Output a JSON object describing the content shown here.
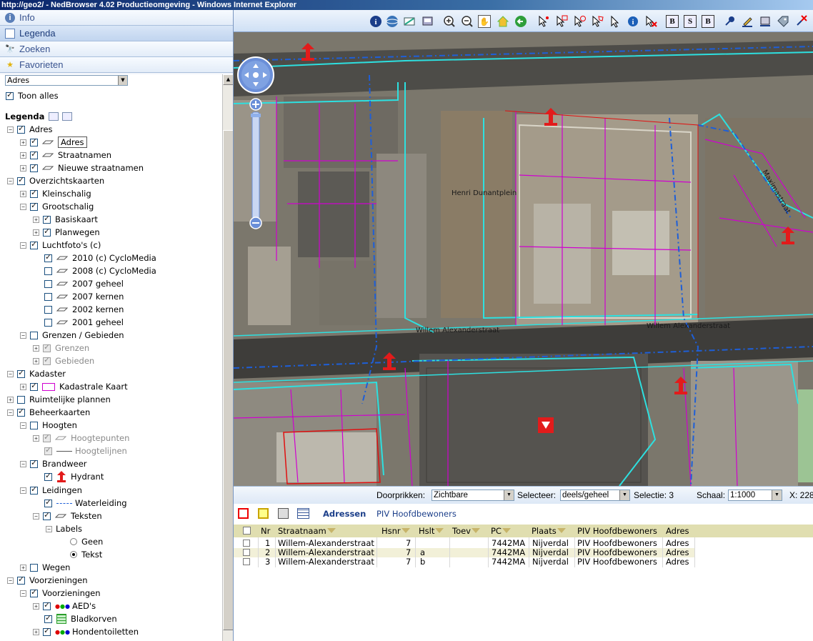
{
  "window": {
    "title": "http://geo2/ - NedBrowser 4.02 Productieomgeving - Windows Internet Explorer"
  },
  "nav": {
    "info": "Info",
    "legenda": "Legenda",
    "zoeken": "Zoeken",
    "favorieten": "Favorieten"
  },
  "layer_select": {
    "value": "Adres"
  },
  "toon_alles": "Toon alles",
  "legend_title": "Legenda",
  "tree": {
    "adres": "Adres",
    "adres_sub": "Adres",
    "straatnamen": "Straatnamen",
    "nieuwe_straatnamen": "Nieuwe straatnamen",
    "overzichtskaarten": "Overzichtskaarten",
    "kleinschalig": "Kleinschalig",
    "grootschalig": "Grootschalig",
    "basiskaart": "Basiskaart",
    "planwegen": "Planwegen",
    "luchtfotos": "Luchtfoto's (c)",
    "lf2010": "2010 (c) CycloMedia",
    "lf2008": "2008 (c) CycloMedia",
    "lf2007g": "2007 geheel",
    "lf2007k": "2007 kernen",
    "lf2002k": "2002 kernen",
    "lf2001g": "2001 geheel",
    "grenzen_gebieden": "Grenzen / Gebieden",
    "grenzen": "Grenzen",
    "gebieden": "Gebieden",
    "kadaster": "Kadaster",
    "kadastrale_kaart": "Kadastrale Kaart",
    "ruimtelijke_plannen": "Ruimtelijke plannen",
    "beheerkaarten": "Beheerkaarten",
    "hoogten": "Hoogten",
    "hoogtepunten": "Hoogtepunten",
    "hoogtelijnen": "Hoogtelijnen",
    "brandweer": "Brandweer",
    "hydrant": "Hydrant",
    "leidingen": "Leidingen",
    "waterleiding": "Waterleiding",
    "teksten": "Teksten",
    "labels": "Labels",
    "geen": "Geen",
    "tekst": "Tekst",
    "wegen": "Wegen",
    "voorzieningen": "Voorzieningen",
    "voorzieningen_sub": "Voorzieningen",
    "aeds": "AED's",
    "bladkorven": "Bladkorven",
    "hondentoiletten": "Hondentoiletten"
  },
  "map": {
    "street_top": "Henri Dunantplein",
    "street_main_1": "Willem Alexanderstraat",
    "street_main_2": "Willem Alexanderstraat",
    "street_right": "Maximastraat"
  },
  "statusbar": {
    "doorprikken_label": "Doorprikken:",
    "doorprikken_value": "Zichtbare",
    "selecteer_label": "Selecteer:",
    "selecteer_value": "deels/geheel",
    "selectie": "Selectie: 3",
    "schaal_label": "Schaal:",
    "schaal_value": "1:1000",
    "x_label": "X: 228"
  },
  "results": {
    "tab_adressen": "Adressen",
    "tab_piv": "PIV Hoofdbewoners",
    "columns": [
      "Nr",
      "Straatnaam",
      "Hsnr",
      "Hslt",
      "Toev",
      "PC",
      "Plaats",
      "PIV Hoofdbewoners",
      "Adres"
    ],
    "rows": [
      [
        "1",
        "Willem-Alexanderstraat",
        "7",
        "",
        "",
        "7442MA",
        "Nijverdal",
        "PIV Hoofdbewoners",
        "Adres"
      ],
      [
        "2",
        "Willem-Alexanderstraat",
        "7",
        "a",
        "",
        "7442MA",
        "Nijverdal",
        "PIV Hoofdbewoners",
        "Adres"
      ],
      [
        "3",
        "Willem-Alexanderstraat",
        "7",
        "b",
        "",
        "7442MA",
        "Nijverdal",
        "PIV Hoofdbewoners",
        "Adres"
      ]
    ]
  }
}
